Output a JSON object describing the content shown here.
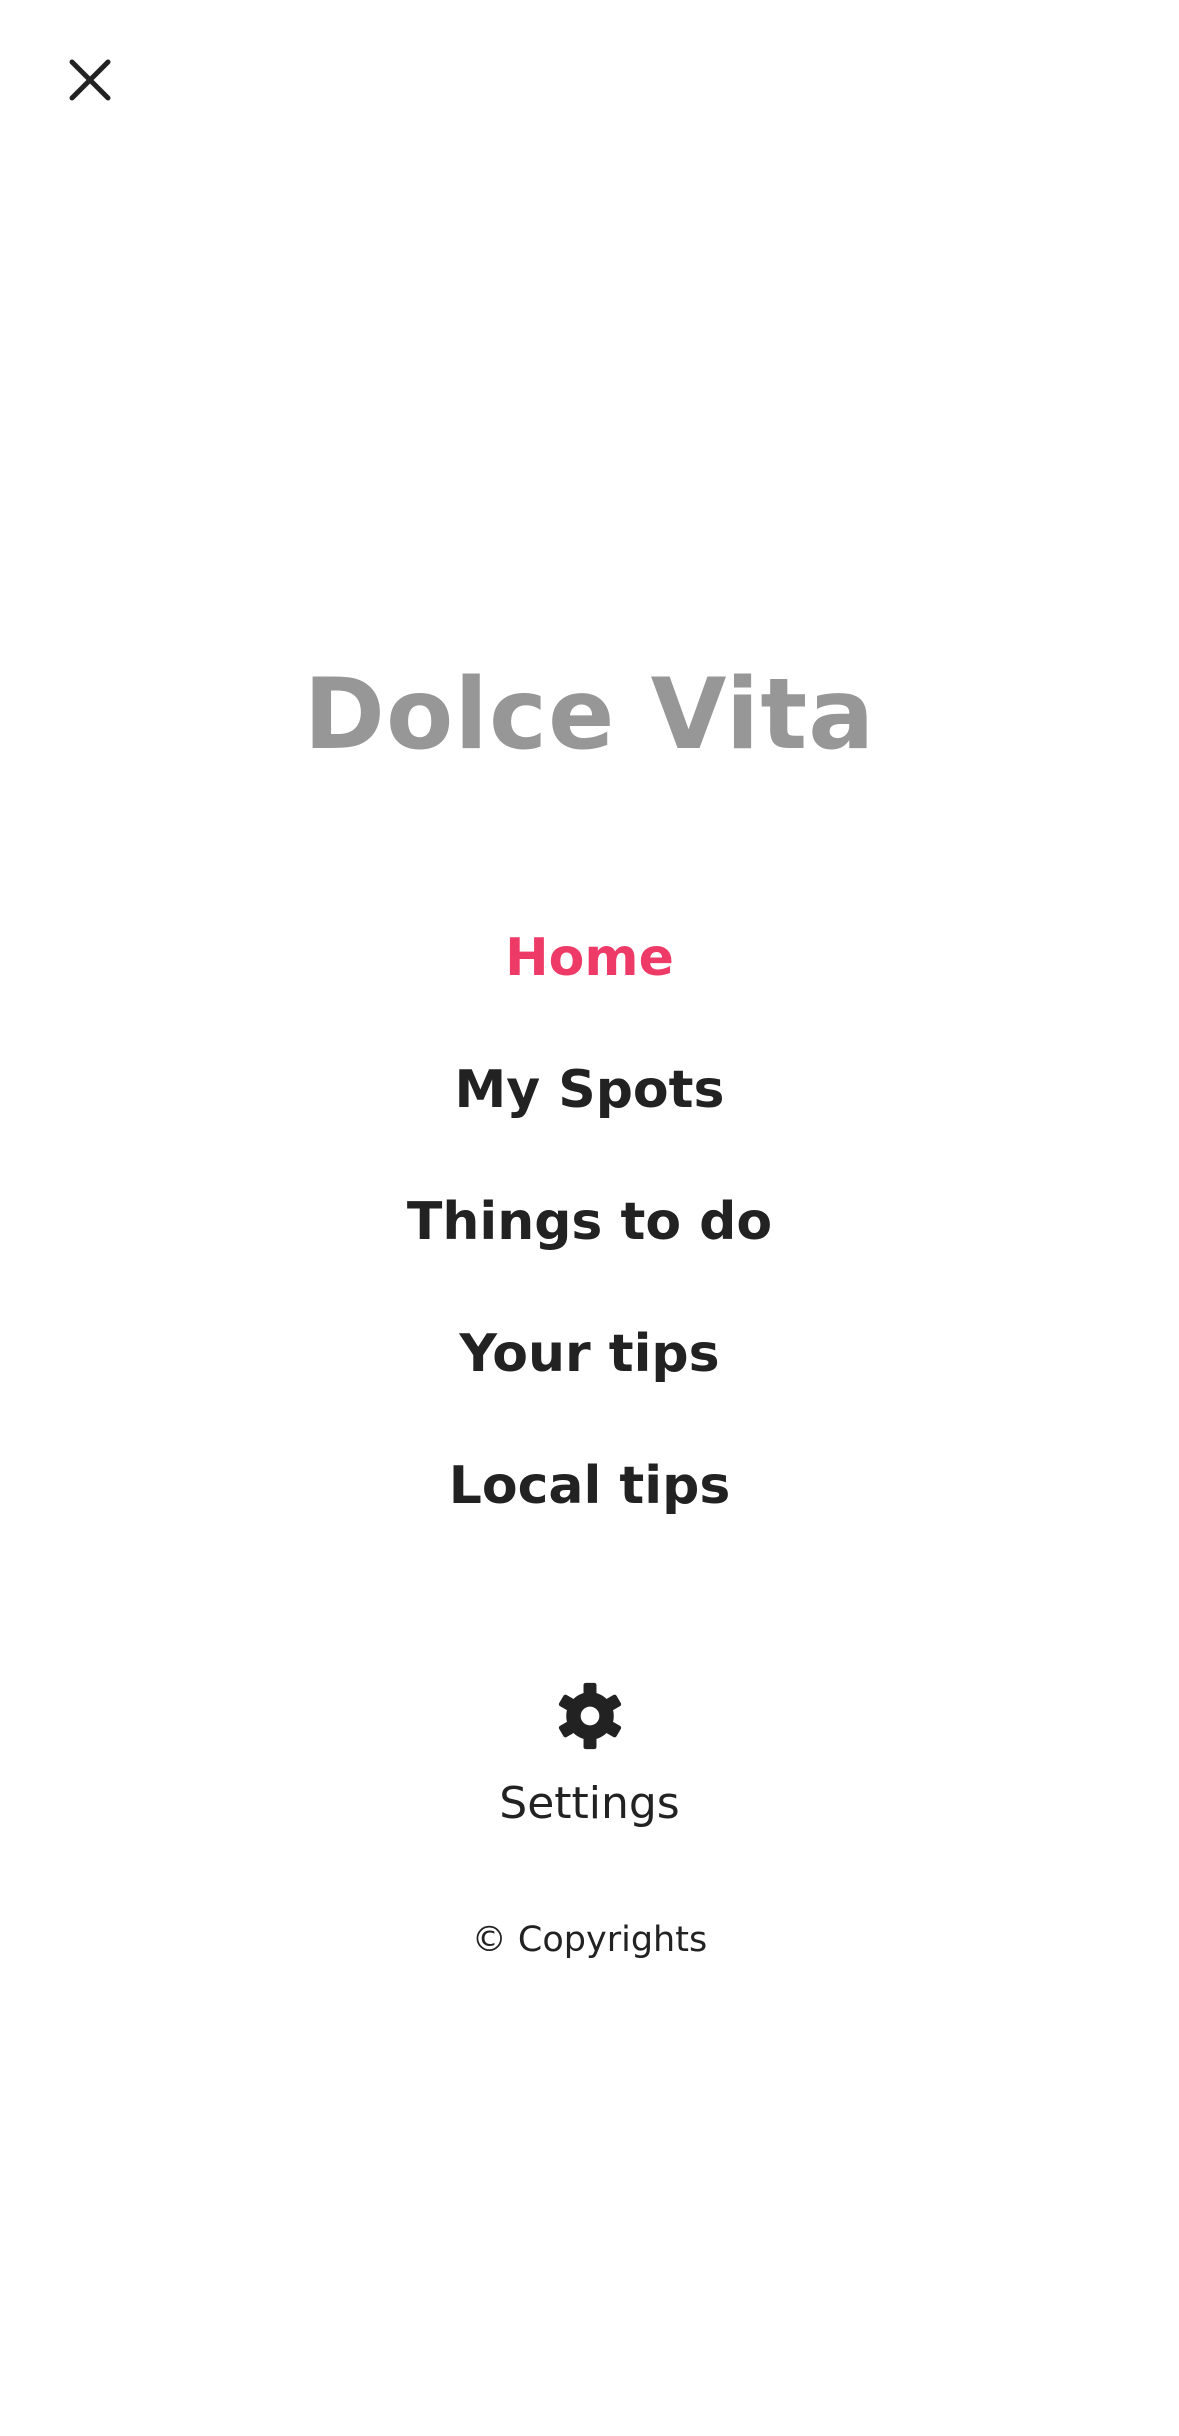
{
  "app": {
    "title": "Dolce Vita"
  },
  "header": {
    "close_icon": "close-icon"
  },
  "nav": {
    "items": [
      {
        "label": "Home",
        "active": true
      },
      {
        "label": "My Spots",
        "active": false
      },
      {
        "label": "Things to do",
        "active": false
      },
      {
        "label": "Your tips",
        "active": false
      },
      {
        "label": "Local tips",
        "active": false
      }
    ]
  },
  "settings": {
    "icon": "gear-icon",
    "label": "Settings"
  },
  "footer": {
    "copyright": "© Copyrights"
  },
  "colors": {
    "accent": "#ee3a67",
    "title": "#979797",
    "text": "#222222",
    "background": "#ffffff"
  }
}
